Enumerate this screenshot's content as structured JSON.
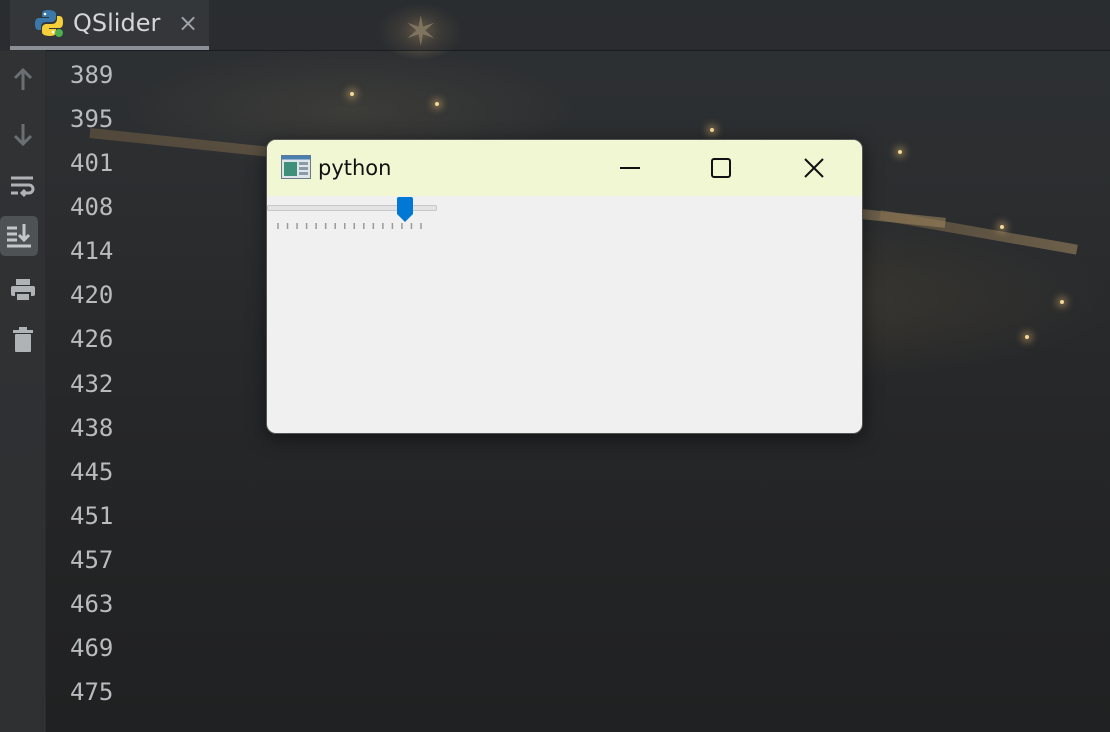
{
  "editor": {
    "tab": {
      "label": "QSlider",
      "close_glyph": "×",
      "icon": "python-icon"
    },
    "toolbar_icons": [
      "arrow-up-icon",
      "arrow-down-icon",
      "soft-wrap-icon",
      "scroll-to-end-icon",
      "print-icon",
      "trash-icon"
    ],
    "line_numbers": [
      "389",
      "395",
      "401",
      "408",
      "414",
      "420",
      "426",
      "432",
      "438",
      "445",
      "451",
      "457",
      "463",
      "469",
      "475"
    ]
  },
  "window": {
    "title": "python",
    "controls": {
      "minimize": "—",
      "maximize": "☐",
      "close": "✕"
    },
    "titlebar_color": "#f2f7d3"
  },
  "slider": {
    "orientation": "horizontal",
    "value_fraction": 0.88,
    "tick_count": 16,
    "handle_color": "#0078d4"
  }
}
